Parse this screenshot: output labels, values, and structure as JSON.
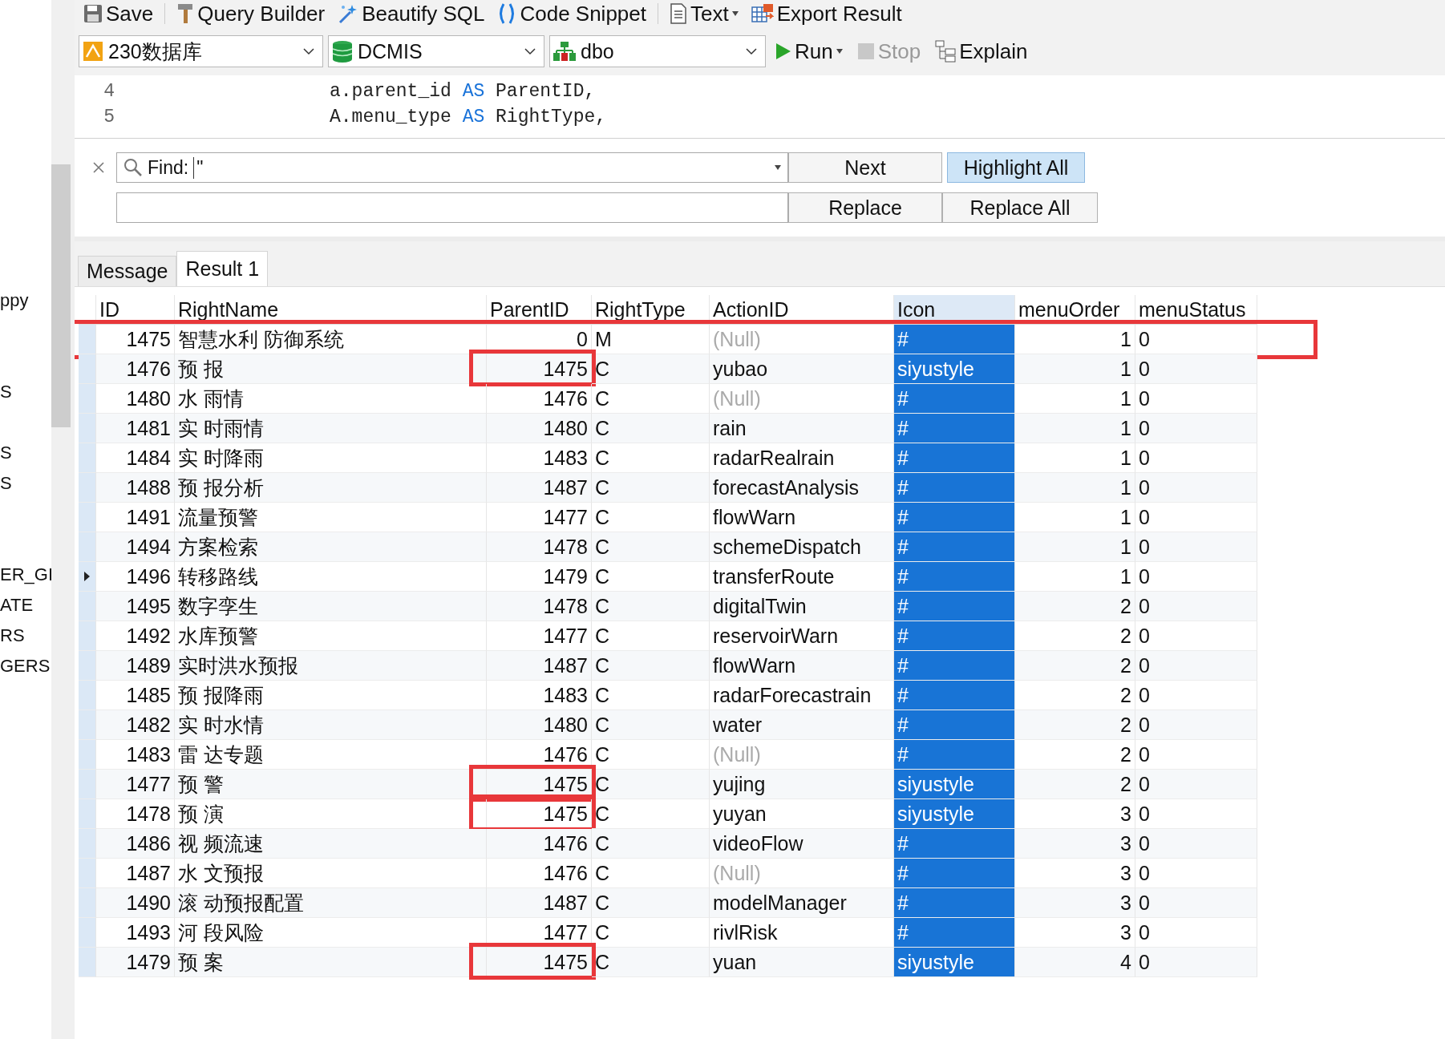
{
  "side_tree": {
    "items": [
      {
        "label": "ppy"
      },
      {
        "label": "S"
      },
      {
        "label": "S"
      },
      {
        "label": "S"
      },
      {
        "label": "ER_GI"
      },
      {
        "label": "ATE"
      },
      {
        "label": "RS"
      },
      {
        "label": "GERS"
      }
    ]
  },
  "toolbar": {
    "buttons": [
      {
        "kind": "save",
        "label": "Save",
        "dropdown": false
      },
      {
        "kind": "builder",
        "label": "Query Builder",
        "dropdown": false
      },
      {
        "kind": "beautify",
        "label": "Beautify SQL",
        "dropdown": false
      },
      {
        "kind": "snippet",
        "label": "Code Snippet",
        "dropdown": false
      },
      {
        "kind": "text",
        "label": "Text",
        "dropdown": true
      },
      {
        "kind": "export",
        "label": "Export Result",
        "dropdown": false
      }
    ]
  },
  "selectors": [
    {
      "kind": "connection",
      "value": "230数据库"
    },
    {
      "kind": "database",
      "value": "DCMIS"
    },
    {
      "kind": "schema",
      "value": "dbo"
    }
  ],
  "run_buttons": [
    {
      "kind": "run",
      "label": "Run",
      "dropdown": true,
      "disabled": false
    },
    {
      "kind": "stop",
      "label": "Stop",
      "dropdown": false,
      "disabled": true
    },
    {
      "kind": "explain",
      "label": "Explain",
      "dropdown": false,
      "disabled": false
    }
  ],
  "editor": {
    "lines": [
      {
        "number": "4",
        "before": "a.parent_id ",
        "keyword": "AS",
        "after": " ParentID,"
      },
      {
        "number": "5",
        "before": "A.menu_type ",
        "keyword": "AS",
        "after": " RightType,"
      }
    ]
  },
  "find_bar": {
    "label": "Find:",
    "value": "\"",
    "buttons": [
      {
        "label": "Next",
        "pressed": false
      },
      {
        "label": "Highlight All",
        "pressed": true
      }
    ],
    "replace_buttons": [
      {
        "label": "Replace",
        "pressed": false
      },
      {
        "label": "Replace All",
        "pressed": false
      }
    ]
  },
  "tabs": [
    {
      "label": "Message",
      "selected": false
    },
    {
      "label": "Result 1",
      "selected": true
    }
  ],
  "grid": {
    "columns": [
      {
        "label": "ID",
        "selected": false
      },
      {
        "label": "RightName",
        "selected": false
      },
      {
        "label": "ParentID",
        "selected": false
      },
      {
        "label": "RightType",
        "selected": false
      },
      {
        "label": "ActionID",
        "selected": false
      },
      {
        "label": "Icon",
        "selected": true
      },
      {
        "label": "menuOrder",
        "selected": false
      },
      {
        "label": "menuStatus",
        "selected": false
      }
    ],
    "rows": [
      {
        "id": "1475",
        "right_name": "智慧水利 防御系统",
        "parent_id": "0",
        "right_type": "M",
        "action_id": "(Null)",
        "action_null": true,
        "icon": "#",
        "menu_order": "1",
        "menu_status": "0",
        "current": false,
        "row_marked": true,
        "parent_marked": false
      },
      {
        "id": "1476",
        "right_name": "预 报",
        "parent_id": "1475",
        "right_type": "C",
        "action_id": "yubao",
        "action_null": false,
        "icon": "siyustyle",
        "menu_order": "1",
        "menu_status": "0",
        "current": false,
        "row_marked": false,
        "parent_marked": true
      },
      {
        "id": "1480",
        "right_name": "水 雨情",
        "parent_id": "1476",
        "right_type": "C",
        "action_id": "(Null)",
        "action_null": true,
        "icon": "#",
        "menu_order": "1",
        "menu_status": "0",
        "current": false,
        "row_marked": false,
        "parent_marked": false
      },
      {
        "id": "1481",
        "right_name": "实 时雨情",
        "parent_id": "1480",
        "right_type": "C",
        "action_id": "rain",
        "action_null": false,
        "icon": "#",
        "menu_order": "1",
        "menu_status": "0",
        "current": false,
        "row_marked": false,
        "parent_marked": false
      },
      {
        "id": "1484",
        "right_name": "实 时降雨",
        "parent_id": "1483",
        "right_type": "C",
        "action_id": "radarRealrain",
        "action_null": false,
        "icon": "#",
        "menu_order": "1",
        "menu_status": "0",
        "current": false,
        "row_marked": false,
        "parent_marked": false
      },
      {
        "id": "1488",
        "right_name": "预 报分析",
        "parent_id": "1487",
        "right_type": "C",
        "action_id": "forecastAnalysis",
        "action_null": false,
        "icon": "#",
        "menu_order": "1",
        "menu_status": "0",
        "current": false,
        "row_marked": false,
        "parent_marked": false
      },
      {
        "id": "1491",
        "right_name": "流量预警",
        "parent_id": "1477",
        "right_type": "C",
        "action_id": "flowWarn",
        "action_null": false,
        "icon": "#",
        "menu_order": "1",
        "menu_status": "0",
        "current": false,
        "row_marked": false,
        "parent_marked": false
      },
      {
        "id": "1494",
        "right_name": "方案检索",
        "parent_id": "1478",
        "right_type": "C",
        "action_id": "schemeDispatch",
        "action_null": false,
        "icon": "#",
        "menu_order": "1",
        "menu_status": "0",
        "current": false,
        "row_marked": false,
        "parent_marked": false
      },
      {
        "id": "1496",
        "right_name": "转移路线",
        "parent_id": "1479",
        "right_type": "C",
        "action_id": "transferRoute",
        "action_null": false,
        "icon": "#",
        "menu_order": "1",
        "menu_status": "0",
        "current": true,
        "row_marked": false,
        "parent_marked": false
      },
      {
        "id": "1495",
        "right_name": "数字孪生",
        "parent_id": "1478",
        "right_type": "C",
        "action_id": "digitalTwin",
        "action_null": false,
        "icon": "#",
        "menu_order": "2",
        "menu_status": "0",
        "current": false,
        "row_marked": false,
        "parent_marked": false
      },
      {
        "id": "1492",
        "right_name": "水库预警",
        "parent_id": "1477",
        "right_type": "C",
        "action_id": "reservoirWarn",
        "action_null": false,
        "icon": "#",
        "menu_order": "2",
        "menu_status": "0",
        "current": false,
        "row_marked": false,
        "parent_marked": false
      },
      {
        "id": "1489",
        "right_name": "实时洪水预报",
        "parent_id": "1487",
        "right_type": "C",
        "action_id": "flowWarn",
        "action_null": false,
        "icon": "#",
        "menu_order": "2",
        "menu_status": "0",
        "current": false,
        "row_marked": false,
        "parent_marked": false
      },
      {
        "id": "1485",
        "right_name": "预 报降雨",
        "parent_id": "1483",
        "right_type": "C",
        "action_id": "radarForecastrain",
        "action_null": false,
        "icon": "#",
        "menu_order": "2",
        "menu_status": "0",
        "current": false,
        "row_marked": false,
        "parent_marked": false
      },
      {
        "id": "1482",
        "right_name": "实 时水情",
        "parent_id": "1480",
        "right_type": "C",
        "action_id": "water",
        "action_null": false,
        "icon": "#",
        "menu_order": "2",
        "menu_status": "0",
        "current": false,
        "row_marked": false,
        "parent_marked": false
      },
      {
        "id": "1483",
        "right_name": "雷 达专题",
        "parent_id": "1476",
        "right_type": "C",
        "action_id": "(Null)",
        "action_null": true,
        "icon": "#",
        "menu_order": "2",
        "menu_status": "0",
        "current": false,
        "row_marked": false,
        "parent_marked": false
      },
      {
        "id": "1477",
        "right_name": "预 警",
        "parent_id": "1475",
        "right_type": "C",
        "action_id": "yujing",
        "action_null": false,
        "icon": "siyustyle",
        "menu_order": "2",
        "menu_status": "0",
        "current": false,
        "row_marked": false,
        "parent_marked": true
      },
      {
        "id": "1478",
        "right_name": "预 演",
        "parent_id": "1475",
        "right_type": "C",
        "action_id": "yuyan",
        "action_null": false,
        "icon": "siyustyle",
        "menu_order": "3",
        "menu_status": "0",
        "current": false,
        "row_marked": false,
        "parent_marked": true
      },
      {
        "id": "1486",
        "right_name": "视 频流速",
        "parent_id": "1476",
        "right_type": "C",
        "action_id": "videoFlow",
        "action_null": false,
        "icon": "#",
        "menu_order": "3",
        "menu_status": "0",
        "current": false,
        "row_marked": false,
        "parent_marked": false
      },
      {
        "id": "1487",
        "right_name": "水 文预报",
        "parent_id": "1476",
        "right_type": "C",
        "action_id": "(Null)",
        "action_null": true,
        "icon": "#",
        "menu_order": "3",
        "menu_status": "0",
        "current": false,
        "row_marked": false,
        "parent_marked": false
      },
      {
        "id": "1490",
        "right_name": "滚 动预报配置",
        "parent_id": "1487",
        "right_type": "C",
        "action_id": "modelManager",
        "action_null": false,
        "icon": "#",
        "menu_order": "3",
        "menu_status": "0",
        "current": false,
        "row_marked": false,
        "parent_marked": false
      },
      {
        "id": "1493",
        "right_name": "河 段风险",
        "parent_id": "1477",
        "right_type": "C",
        "action_id": "rivlRisk",
        "action_null": false,
        "icon": "#",
        "menu_order": "3",
        "menu_status": "0",
        "current": false,
        "row_marked": false,
        "parent_marked": false
      },
      {
        "id": "1479",
        "right_name": "预 案",
        "parent_id": "1475",
        "right_type": "C",
        "action_id": "yuan",
        "action_null": false,
        "icon": "siyustyle",
        "menu_order": "4",
        "menu_status": "0",
        "current": false,
        "row_marked": false,
        "parent_marked": true
      }
    ]
  }
}
